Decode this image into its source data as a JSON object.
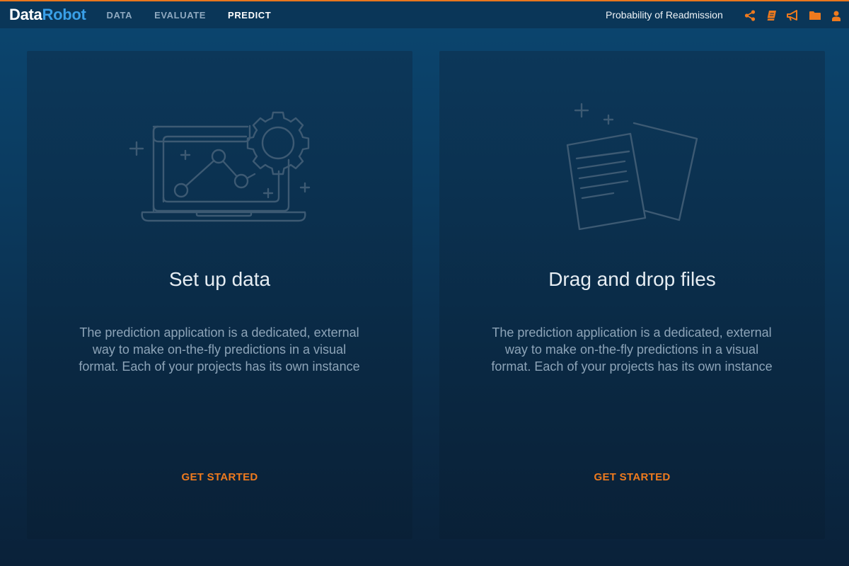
{
  "header": {
    "logo_part1": "Data",
    "logo_part2": "Robot",
    "nav": [
      {
        "label": "DATA",
        "active": false
      },
      {
        "label": "EVALUATE",
        "active": false
      },
      {
        "label": "PREDICT",
        "active": true
      }
    ],
    "project_name": "Probability of Readmission",
    "icons": [
      "share-icon",
      "book-icon",
      "megaphone-icon",
      "folder-icon",
      "user-icon"
    ]
  },
  "cards": [
    {
      "title": "Set up data",
      "description": "The prediction application is a dedicated, external way to make on-the-fly predictions in a visual format. Each of your projects has its own instance",
      "cta": "GET STARTED",
      "illustration": "laptop-chart-gear-icon"
    },
    {
      "title": "Drag and drop files",
      "description": "The prediction application is a dedicated, external way to make on-the-fly predictions in a visual format. Each of your projects has its own instance",
      "cta": "GET STARTED",
      "illustration": "documents-icon"
    }
  ],
  "colors": {
    "accent": "#ee7a1e",
    "logo_blue": "#3aa0e8",
    "illustration_stroke": "#3d5a73"
  }
}
